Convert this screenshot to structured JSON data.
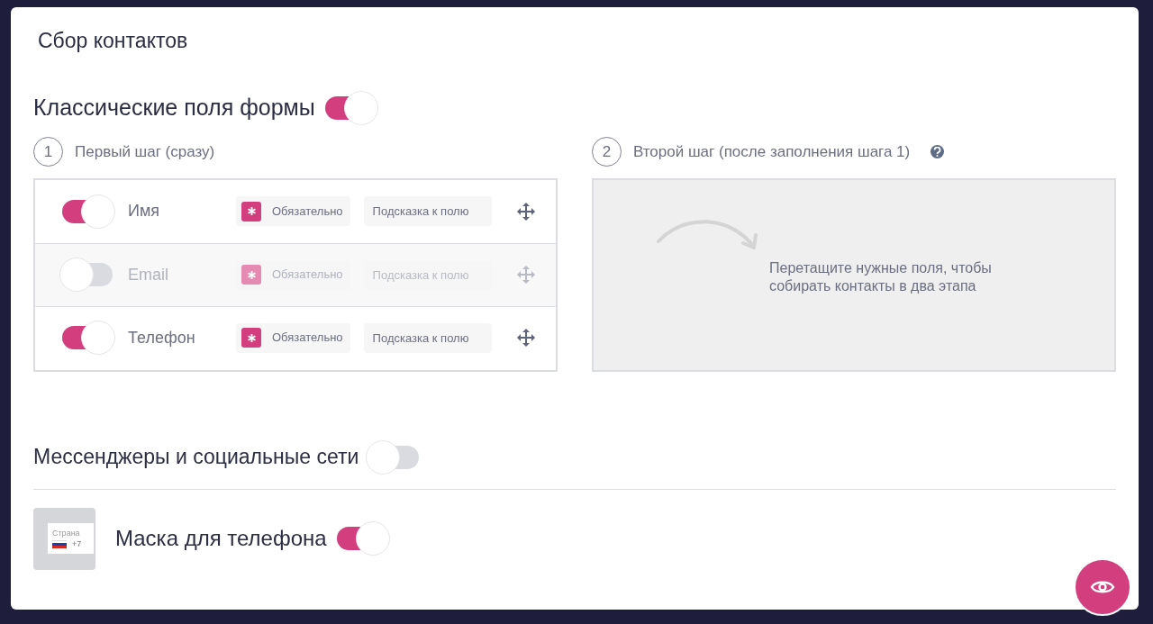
{
  "title": "Сбор контактов",
  "classic": {
    "label": "Классические поля формы",
    "on": true
  },
  "steps": [
    {
      "number": "1",
      "label": "Первый шаг (сразу)"
    },
    {
      "number": "2",
      "label": "Второй шаг (после заполнения шага 1)"
    }
  ],
  "fields": [
    {
      "label": "Имя",
      "on": true,
      "required": {
        "label": "Обязательно",
        "checked": true
      },
      "hint": {
        "placeholder": "Подсказка к полю"
      }
    },
    {
      "label": "Email",
      "on": false,
      "required": {
        "label": "Обязательно",
        "checked": true
      },
      "hint": {
        "placeholder": "Подсказка к полю"
      }
    },
    {
      "label": "Телефон",
      "on": true,
      "required": {
        "label": "Обязательно",
        "checked": true
      },
      "hint": {
        "placeholder": "Подсказка к полю"
      }
    }
  ],
  "dropzone": {
    "text": "Перетащите нужные поля, чтобы собирать контакты в два этапа"
  },
  "messengers": {
    "label": "Мессенджеры и социальные сети",
    "on": false
  },
  "phone_mask": {
    "label": "Маска для телефона",
    "on": true,
    "preview": {
      "caption": "Страна",
      "code": "+7"
    }
  }
}
